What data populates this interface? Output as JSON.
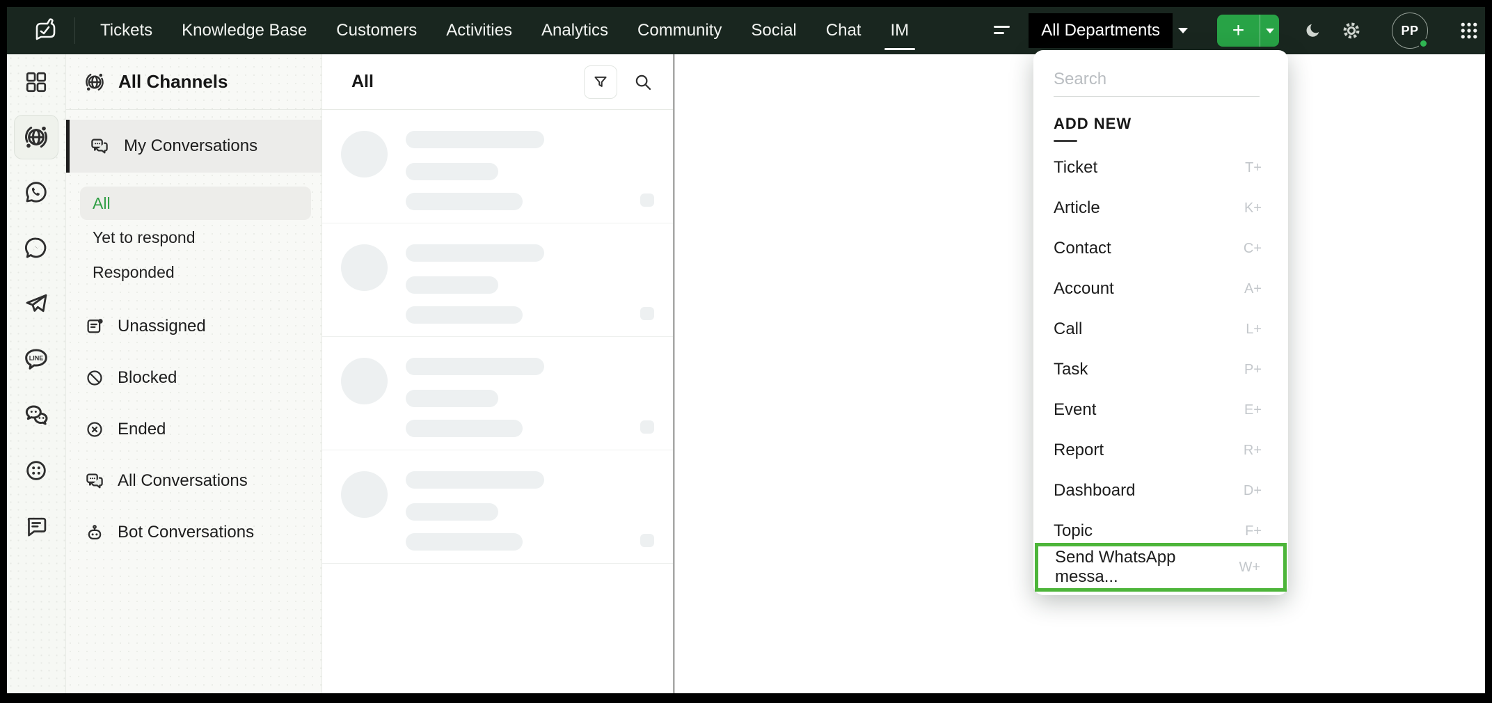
{
  "nav": {
    "items": [
      {
        "label": "Tickets"
      },
      {
        "label": "Knowledge Base"
      },
      {
        "label": "Customers"
      },
      {
        "label": "Activities"
      },
      {
        "label": "Analytics"
      },
      {
        "label": "Community"
      },
      {
        "label": "Social"
      },
      {
        "label": "Chat"
      },
      {
        "label": "IM"
      }
    ],
    "active_item": "IM",
    "department_selector": "All Departments",
    "add_button_label": "+",
    "avatar_initials": "PP"
  },
  "channel_rail": {
    "items": [
      {
        "icon": "modules-grid-icon"
      },
      {
        "icon": "all-channels-globe-icon",
        "selected": true
      },
      {
        "icon": "whatsapp-icon"
      },
      {
        "icon": "messenger-icon"
      },
      {
        "icon": "telegram-icon"
      },
      {
        "icon": "line-icon"
      },
      {
        "icon": "wechat-icon"
      },
      {
        "icon": "custom-channel-icon"
      },
      {
        "icon": "sms-icon"
      }
    ]
  },
  "sidebar": {
    "title": "All Channels",
    "my_conversations": {
      "label": "My Conversations",
      "selected": true
    },
    "filters": [
      {
        "label": "All",
        "selected": true
      },
      {
        "label": "Yet to respond"
      },
      {
        "label": "Responded"
      }
    ],
    "items": [
      {
        "label": "Unassigned",
        "icon": "unassigned-icon"
      },
      {
        "label": "Blocked",
        "icon": "blocked-icon"
      },
      {
        "label": "Ended",
        "icon": "ended-icon"
      },
      {
        "label": "All Conversations",
        "icon": "conversations-icon"
      },
      {
        "label": "Bot Conversations",
        "icon": "bot-icon"
      }
    ]
  },
  "list_panel": {
    "title": "All",
    "skeleton_rows": 4
  },
  "add_new_menu": {
    "search_placeholder": "Search",
    "section_label": "ADD NEW",
    "items": [
      {
        "label": "Ticket",
        "shortcut": "T+"
      },
      {
        "label": "Article",
        "shortcut": "K+"
      },
      {
        "label": "Contact",
        "shortcut": "C+"
      },
      {
        "label": "Account",
        "shortcut": "A+"
      },
      {
        "label": "Call",
        "shortcut": "L+"
      },
      {
        "label": "Task",
        "shortcut": "P+"
      },
      {
        "label": "Event",
        "shortcut": "E+"
      },
      {
        "label": "Report",
        "shortcut": "R+"
      },
      {
        "label": "Dashboard",
        "shortcut": "D+"
      },
      {
        "label": "Topic",
        "shortcut": "F+"
      },
      {
        "label": "Send WhatsApp messa...",
        "shortcut": "W+",
        "highlighted": true
      }
    ]
  },
  "colors": {
    "nav_bg": "#19261f",
    "accent_green": "#28a346",
    "highlight_border_green": "#4db53a",
    "selected_filter_green": "#2f9e44",
    "presence_green": "#2fb552"
  }
}
